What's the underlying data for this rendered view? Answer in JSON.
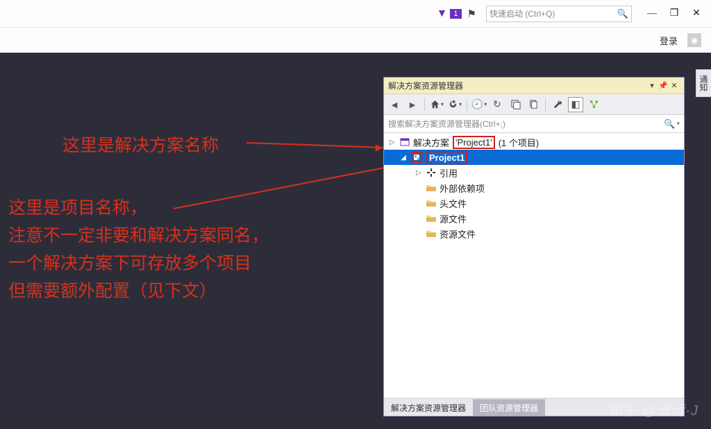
{
  "titlebar": {
    "notif_count": "1",
    "quick_launch_placeholder": "快速启动 (Ctrl+Q)"
  },
  "secondbar": {
    "login_label": "登录"
  },
  "annotations": {
    "line1": "这里是解决方案名称",
    "block_l1": "这里是项目名称，",
    "block_l2": "注意不一定非要和解决方案同名，",
    "block_l3": "一个解决方案下可存放多个项目",
    "block_l4": "但需要额外配置（见下文）"
  },
  "panel": {
    "title": "解决方案资源管理器",
    "search_placeholder": "搜索解决方案资源管理器(Ctrl+;)",
    "tree": {
      "solution_prefix": "解决方案",
      "solution_name": "Project1",
      "solution_suffix": "(1 个项目)",
      "project_name": "Project1",
      "refs": "引用",
      "ext_deps": "外部依赖项",
      "headers": "头文件",
      "sources": "源文件",
      "resources": "资源文件"
    },
    "tabs": {
      "active": "解决方案资源管理器",
      "inactive": "团队资源管理器"
    }
  },
  "sidetab": {
    "label": "通知"
  },
  "watermark": "知乎 @追远·J"
}
